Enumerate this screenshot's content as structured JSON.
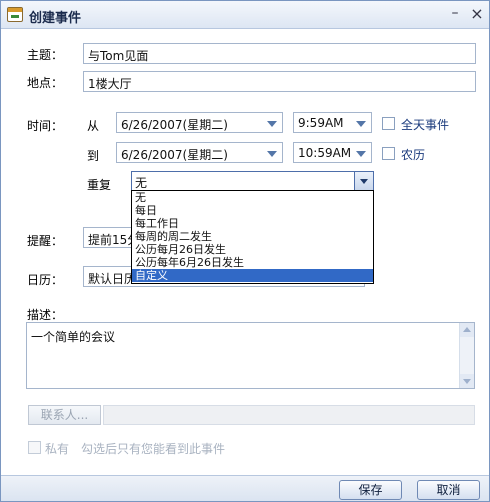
{
  "window": {
    "title": "创建事件",
    "minimize_glyph": "–",
    "close_glyph": "×"
  },
  "form": {
    "subject": {
      "label": "主题：",
      "value": "与Tom见面"
    },
    "location": {
      "label": "地点：",
      "value": "1楼大厅"
    },
    "time": {
      "label": "时间：",
      "from_label": "从",
      "to_label": "到",
      "from_date": "6/26/2007(星期二)",
      "from_time": "9:59AM",
      "to_date": "6/26/2007(星期二)",
      "to_time": "10:59AM",
      "all_day_label": "全天事件",
      "lunar_label": "农历"
    },
    "repeat": {
      "label": "重复",
      "selected": "无",
      "options": [
        "无",
        "每日",
        "每工作日",
        "每周的周二发生",
        "公历每月26日发生",
        "公历每年6月26日发生",
        "自定义"
      ],
      "highlighted_index": 6
    },
    "reminder": {
      "label": "提醒：",
      "value": "提前15分"
    },
    "calendar": {
      "label": "日历：",
      "value": "默认日历"
    },
    "description": {
      "label": "描述：",
      "value": "一个简单的会议"
    },
    "contacts_button": "联系人...",
    "private": {
      "label": "私有",
      "hint": "勾选后只有您能看到此事件"
    }
  },
  "footer": {
    "save_label": "保存",
    "cancel_label": "取消"
  },
  "colors": {
    "accent": "#3169c6",
    "label_link": "#1b3b7d",
    "border": "#a5b5cc"
  }
}
